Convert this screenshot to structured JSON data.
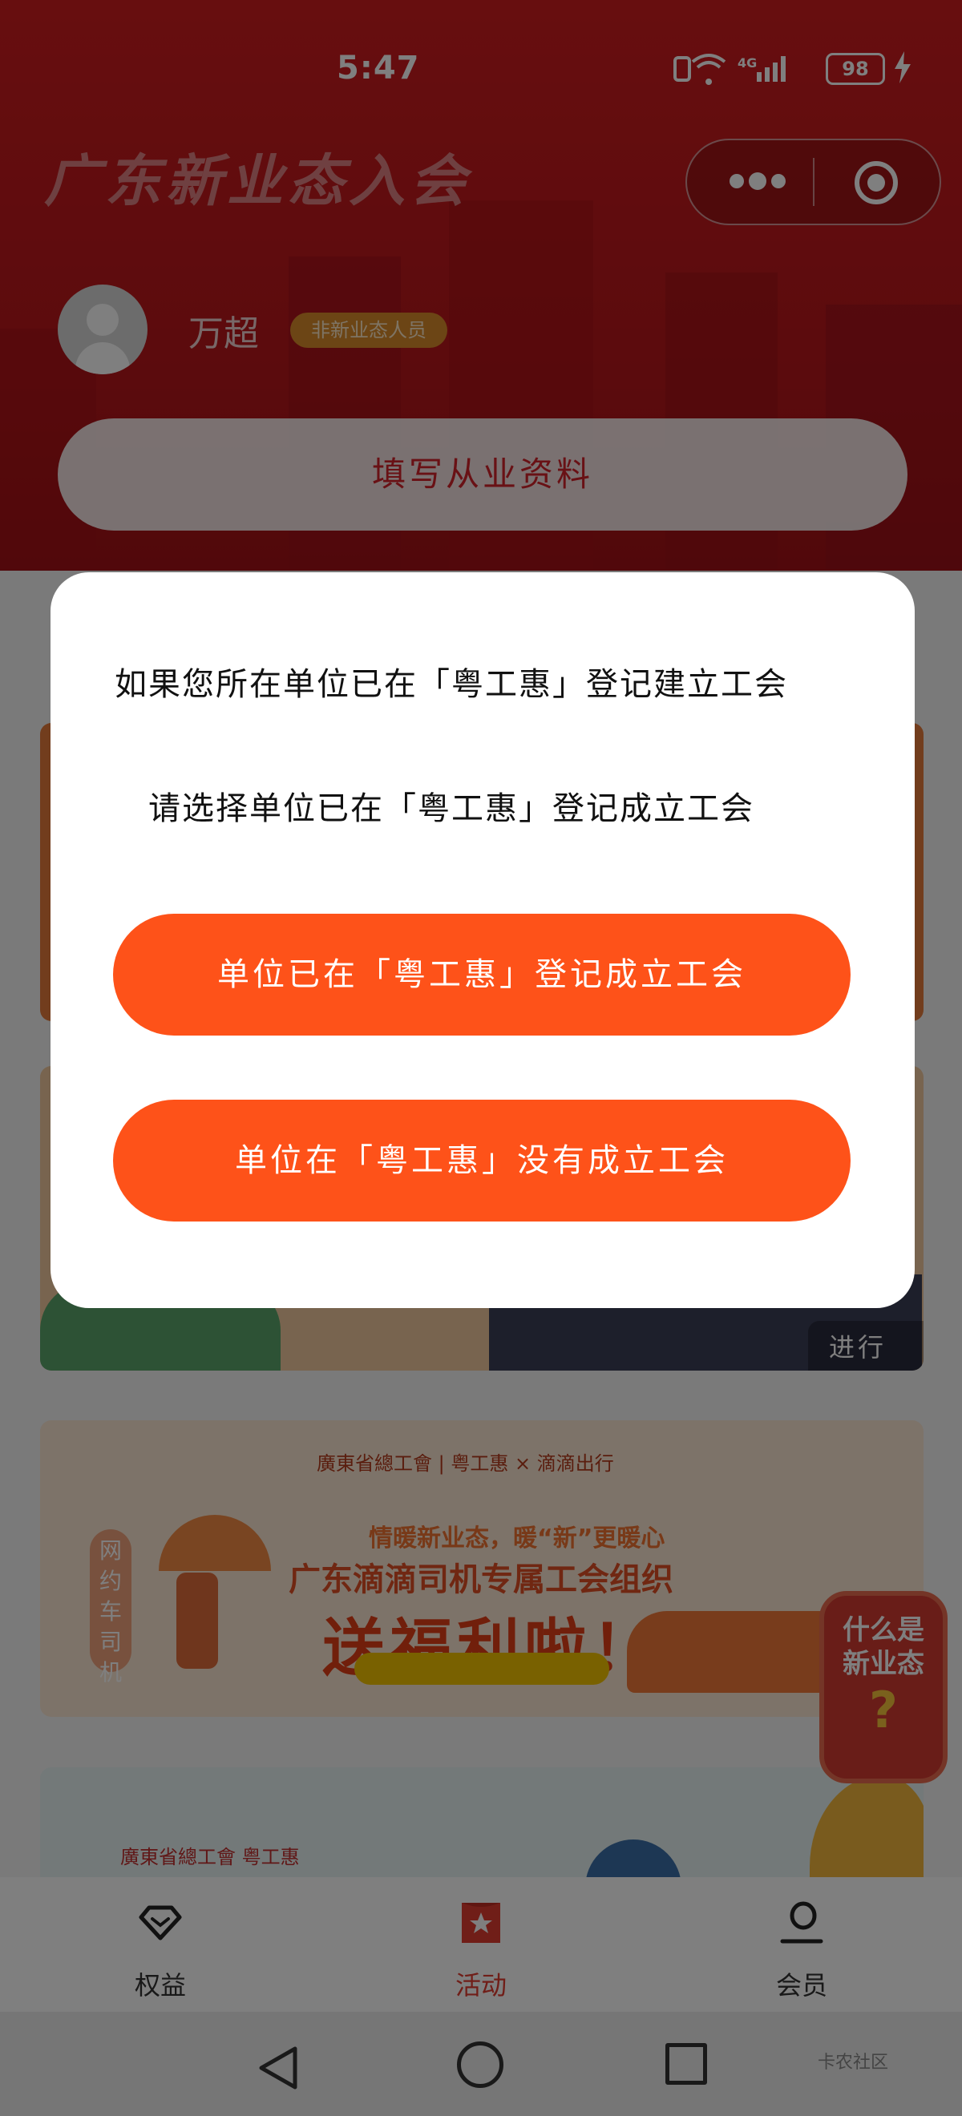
{
  "status_bar": {
    "time": "5:47",
    "network": "4G",
    "battery": "98"
  },
  "header": {
    "title": "广东新业态入会",
    "user_name": "万超",
    "role_badge": "非新业态人员",
    "fill_button": "填写从业资料"
  },
  "cards": [
    {
      "status": "进行中"
    },
    {
      "logo_line": "廣東省總工會 | 粤工惠 × 滴滴出行",
      "tagline": "情暖新业态，暖“新”更暖心",
      "headline": "广东滴滴司机专属工会组织",
      "big_text": "送福利啦！",
      "vertical_label": "网约车司机",
      "status": "进"
    },
    {
      "logo_line": "廣東省總工會  粤工惠"
    }
  ],
  "float_button": {
    "line1": "什么是",
    "line2": "新业态",
    "mark": "?"
  },
  "modal": {
    "message": "如果您所在单位已在「粤工惠」登记建立工会",
    "message2": "请选择单位已在「粤工惠」登记成立工会",
    "button_registered": "单位已在「粤工惠」登记成立工会",
    "button_not_registered": "单位在「粤工惠」没有成立工会"
  },
  "tabbar": {
    "items": [
      {
        "label": "权益",
        "icon": "diamond-icon"
      },
      {
        "label": "活动",
        "icon": "star-bookmark-icon"
      },
      {
        "label": "会员",
        "icon": "member-icon"
      }
    ],
    "active_color": "#e03c31"
  },
  "navbar": {
    "watermark": "卡农社区"
  },
  "colors": {
    "primary_button": "#fe5219",
    "header_red": "#cf1c1f"
  }
}
